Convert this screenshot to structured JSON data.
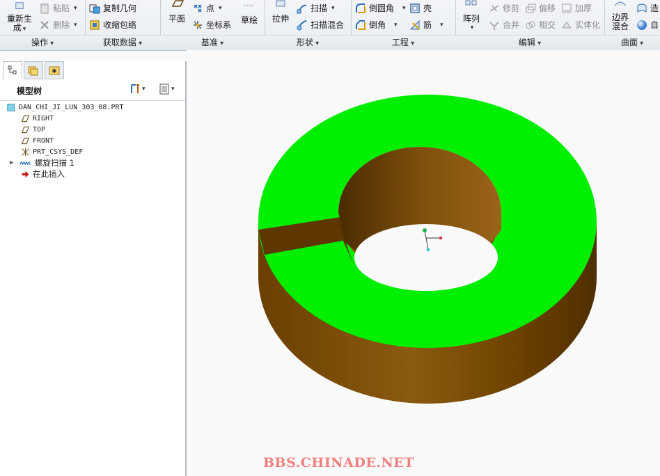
{
  "ribbon": {
    "groups": {
      "operations": "操作",
      "get_data": "获取数据",
      "datum": "基准",
      "shapes": "形状",
      "engineering": "工程",
      "editing": "编辑",
      "surfaces": "曲面"
    },
    "operations": {
      "regenerate_line1": "重新生",
      "regenerate_line2": "成",
      "paste": "粘贴",
      "delete": "删除"
    },
    "get_data": {
      "copy_geometry": "复制几何",
      "shrinkwrap": "收缩包络"
    },
    "datum": {
      "plane": "平面",
      "point": "点",
      "csys": "坐标系",
      "sketch": "草绘"
    },
    "shapes": {
      "extrude": "拉伸",
      "sweep": "扫描",
      "swept_blend": "扫描混合"
    },
    "engineering": {
      "round": "倒圆角",
      "chamfer": "倒角",
      "shell": "壳",
      "rib": "筋"
    },
    "editing": {
      "pattern": "阵列",
      "trim": "修剪",
      "merge": "合并",
      "offset": "偏移",
      "intersect": "相交",
      "thicken": "加厚",
      "solidify": "实体化"
    },
    "surfaces": {
      "boundary_line1": "边界",
      "boundary_line2": "混合",
      "style_partial": "造",
      "freeform_partial": "自"
    }
  },
  "model_tree": {
    "title": "模型树",
    "items": [
      {
        "label": "DAN_CHI_JI_LUN_303_08.PRT",
        "icon": "part-icon"
      },
      {
        "label": "RIGHT",
        "icon": "datum-plane-icon"
      },
      {
        "label": "TOP",
        "icon": "datum-plane-icon"
      },
      {
        "label": "FRONT",
        "icon": "datum-plane-icon"
      },
      {
        "label": "PRT_CSYS_DEF",
        "icon": "csys-icon"
      },
      {
        "label": "螺旋扫描 1",
        "icon": "helical-sweep-icon"
      },
      {
        "label": "在此插入",
        "icon": "insert-here-arrow-icon"
      }
    ]
  },
  "watermark": "BBS.CHINADE.NET",
  "colors": {
    "face_green": "#00ee00",
    "body_brown": "#7a4a06",
    "dark_brown": "#4a2b00"
  }
}
